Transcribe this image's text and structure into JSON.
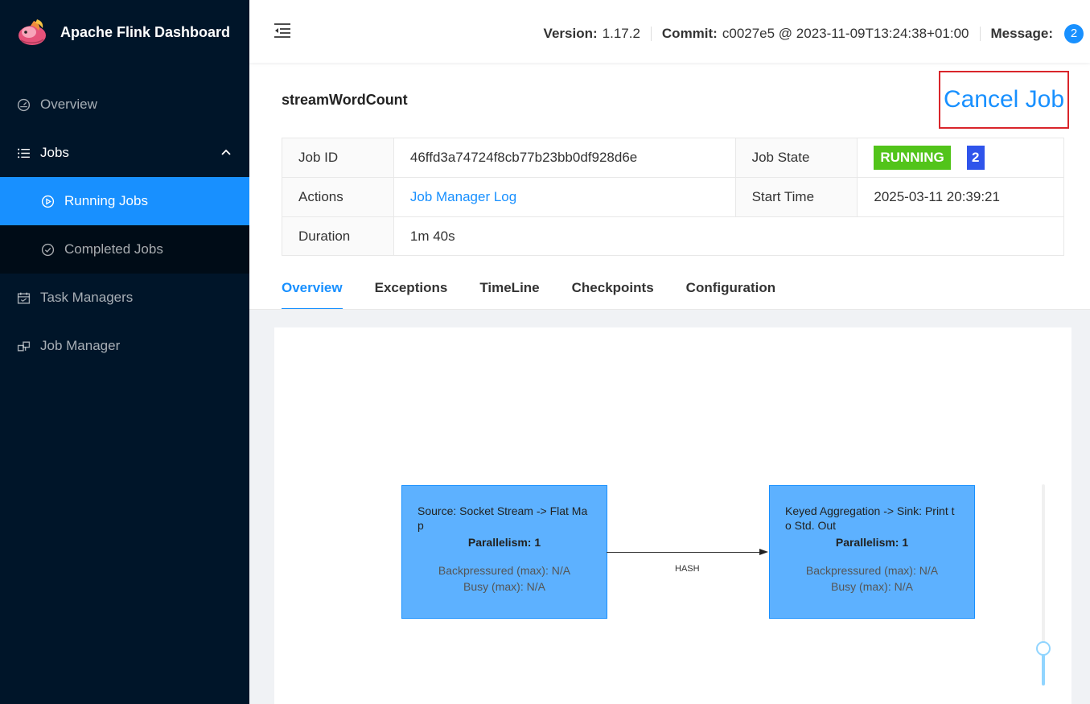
{
  "sidebar": {
    "brand": "Apache Flink Dashboard",
    "items": [
      {
        "label": "Overview",
        "icon": "dashboard-icon"
      },
      {
        "label": "Jobs",
        "icon": "unordered-list-icon"
      },
      {
        "label": "Task Managers",
        "icon": "schedule-icon"
      },
      {
        "label": "Job Manager",
        "icon": "build-icon"
      }
    ],
    "jobs_sub": [
      {
        "label": "Running Jobs",
        "icon": "play-circle-icon"
      },
      {
        "label": "Completed Jobs",
        "icon": "check-circle-icon"
      }
    ]
  },
  "header": {
    "version_label": "Version:",
    "version": "1.17.2",
    "commit_label": "Commit:",
    "commit": "c0027e5 @ 2023-11-09T13:24:38+01:00",
    "message_label": "Message:",
    "message_count": "2"
  },
  "job": {
    "name": "streamWordCount",
    "cancel_label": "Cancel Job",
    "id_label": "Job ID",
    "id": "46ffd3a74724f8cb77b23bb0df928d6e",
    "state_label": "Job State",
    "state": "RUNNING",
    "state_count": "2",
    "actions_label": "Actions",
    "actions_link": "Job Manager Log",
    "start_label": "Start Time",
    "start_time": "2025-03-11 20:39:21",
    "duration_label": "Duration",
    "duration": "1m 40s"
  },
  "tabs": [
    "Overview",
    "Exceptions",
    "TimeLine",
    "Checkpoints",
    "Configuration"
  ],
  "graph": {
    "nodes": [
      {
        "name": "Source: Socket Stream -> Flat Map",
        "parallelism": "Parallelism: 1",
        "backpressure": "Backpressured (max): N/A",
        "busy": "Busy (max): N/A"
      },
      {
        "name": "Keyed Aggregation -> Sink: Print to Std. Out",
        "parallelism": "Parallelism: 1",
        "backpressure": "Backpressured (max): N/A",
        "busy": "Busy (max): N/A"
      }
    ],
    "edge_label": "HASH"
  },
  "colors": {
    "sidebar_bg": "#001529",
    "accent": "#1890ff",
    "running": "#52c41a",
    "node_fill": "#5db1ff",
    "highlight": "#d9252b"
  }
}
